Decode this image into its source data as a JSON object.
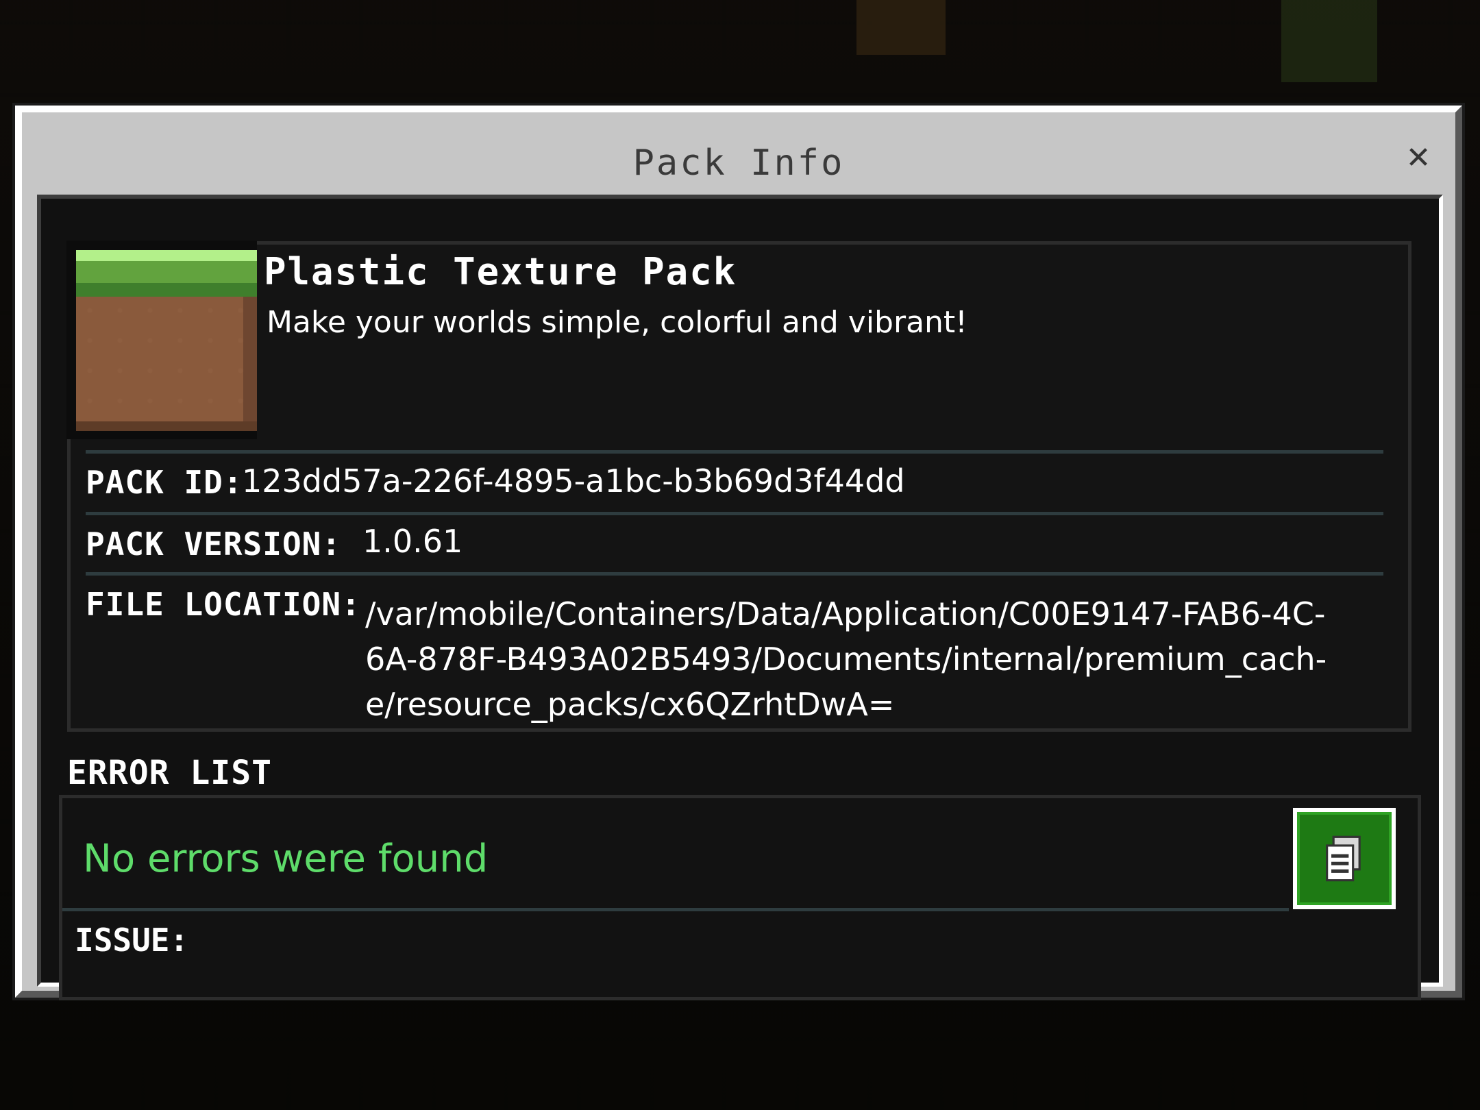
{
  "dialog": {
    "title": "Pack Info",
    "close_icon": "close-icon"
  },
  "pack": {
    "name": "Plastic Texture Pack",
    "description": "Make your worlds simple, colorful and vibrant!",
    "icon": "grass-block-icon"
  },
  "fields": {
    "pack_id_label": "PACK ID:",
    "pack_id_value": "123dd57a-226f-4895-a1bc-b3b69d3f44dd",
    "pack_version_label": "PACK VERSION:",
    "pack_version_value": "1.0.61",
    "file_location_label": "FILE LOCATION:",
    "file_location_lines": [
      "/var/mobile/Containers/Data/Application/C00E9147-FAB6-4C-",
      "6A-878F-B493A02B5493/Documents/internal/premium_cach-",
      "e/resource_packs/cx6QZrhtDwA="
    ]
  },
  "errors": {
    "title": "ERROR LIST",
    "status": "No errors were found",
    "copy_icon": "copy-icon",
    "issue_label": "ISSUE:"
  },
  "colors": {
    "success_text": "#5edc6a",
    "copy_button": "#1e7a14"
  }
}
